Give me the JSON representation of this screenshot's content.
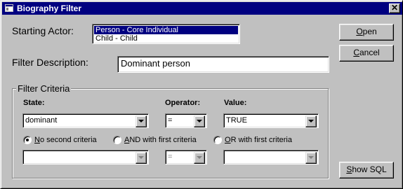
{
  "window": {
    "title": "Biography Filter",
    "close_glyph": "✕"
  },
  "form": {
    "starting_actor_label": "Starting Actor:",
    "actor_list": [
      "Person - Core Individual",
      "Child - Child"
    ],
    "actor_selected_index": 0,
    "filter_description_label": "Filter Description:",
    "filter_description_value": "Dominant person"
  },
  "buttons": {
    "open": {
      "mnemonic": "O",
      "rest": "pen"
    },
    "cancel": {
      "mnemonic": "C",
      "rest": "ancel"
    },
    "show_sql": {
      "mnemonic": "S",
      "rest": "how SQL"
    }
  },
  "criteria": {
    "group_title": "Filter Criteria",
    "state_label": "State:",
    "operator_label": "Operator:",
    "value_label": "Value:",
    "first": {
      "state": "dominant",
      "operator": "=",
      "value": "TRUE"
    },
    "second": {
      "state": "",
      "operator": "=",
      "value": ""
    },
    "radio_options": [
      {
        "mnemonic": "N",
        "rest": "o second criteria",
        "selected": true
      },
      {
        "mnemonic": "A",
        "rest": "ND with first criteria",
        "selected": false
      },
      {
        "mnemonic": "O",
        "rest": "R with first criteria",
        "selected": false
      }
    ]
  },
  "icons": {
    "title": "window-app-icon",
    "close": "close-icon",
    "dropdown": "chevron-down-icon"
  },
  "colors": {
    "face": "#c0c0c0",
    "titlebar": "#000080",
    "selection": "#000080"
  }
}
